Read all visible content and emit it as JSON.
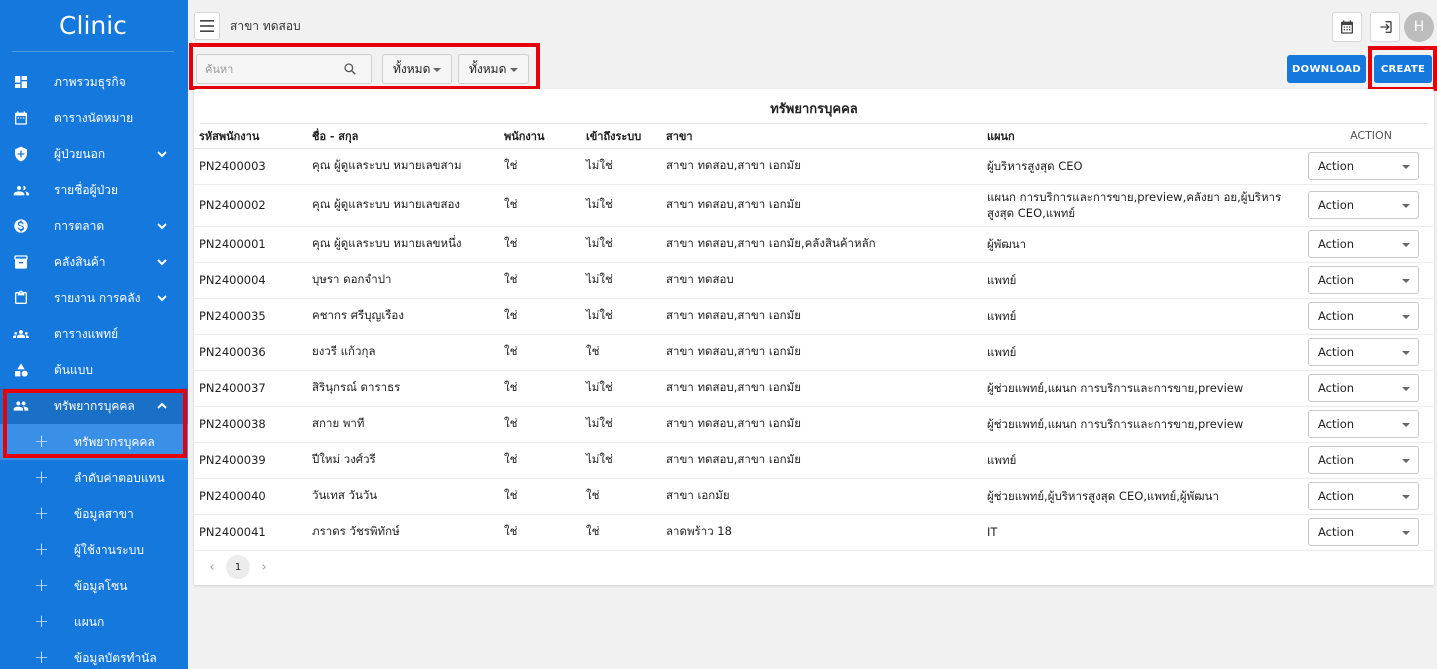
{
  "app": {
    "name": "Clinic"
  },
  "sidebar": {
    "items": [
      {
        "label": "ภาพรวมธุรกิจ",
        "icon": "dashboard-icon",
        "has_chevron": false
      },
      {
        "label": "ตารางนัดหมาย",
        "icon": "calendar-icon",
        "has_chevron": false
      },
      {
        "label": "ผู้ป่วยนอก",
        "icon": "shield-icon",
        "has_chevron": true
      },
      {
        "label": "รายชื่อผู้ป่วย",
        "icon": "patients-icon",
        "has_chevron": false
      },
      {
        "label": "การตลาด",
        "icon": "dollar-icon",
        "has_chevron": true
      },
      {
        "label": "คลังสินค้า",
        "icon": "archive-icon",
        "has_chevron": true
      },
      {
        "label": "รายงาน การคลัง",
        "icon": "clipboard-icon",
        "has_chevron": true
      },
      {
        "label": "ตารางแพทย์",
        "icon": "doctors-icon",
        "has_chevron": false
      },
      {
        "label": "ต้นแบบ",
        "icon": "shapes-icon",
        "has_chevron": false
      },
      {
        "label": "ทรัพยากรบุคคล",
        "icon": "people-icon",
        "has_chevron": true,
        "expanded": true
      }
    ],
    "sub_items": [
      {
        "label": "ทรัพยากรบุคคล",
        "active": true
      },
      {
        "label": "ลำดับค่าตอบแทน"
      },
      {
        "label": "ข้อมูลสาขา"
      },
      {
        "label": "ผู้ใช้งานระบบ"
      },
      {
        "label": "ข้อมูลโซน"
      },
      {
        "label": "แผนก"
      },
      {
        "label": "ข้อมูลบัตรทำนัล"
      }
    ]
  },
  "header": {
    "branch": "สาขา ทดสอบ"
  },
  "toolbar": {
    "search_placeholder": "ค้นหา",
    "filter1": "ทั้งหมด",
    "filter2": "ทั้งหมด",
    "download_label": "DOWNLOAD",
    "create_label": "CREATE"
  },
  "table": {
    "title": "ทรัพยากรบุคคล",
    "columns": [
      "รหัสพนักงาน",
      "ชื่อ - สกุล",
      "พนักงาน",
      "เข้าถึงระบบ",
      "สาขา",
      "แผนก",
      "ACTION"
    ],
    "rows": [
      {
        "id": "PN2400003",
        "name": "คุณ ผู้ดูแลระบบ หมายเลขสาม",
        "staff": "ใช่",
        "access": "ไม่ใช่",
        "branch": "สาขา ทดสอบ,สาขา เอกมัย",
        "dept": "ผู้บริหารสูงสุด CEO",
        "action": "Action"
      },
      {
        "id": "PN2400002",
        "name": "คุณ ผู้ดูแลระบบ หมายเลขสอง",
        "staff": "ใช่",
        "access": "ไม่ใช่",
        "branch": "สาขา ทดสอบ,สาขา เอกมัย",
        "dept": "แผนก การบริการและการขาย,preview,คลังยา อย,ผู้บริหารสูงสุด CEO,แพทย์",
        "action": "Action"
      },
      {
        "id": "PN2400001",
        "name": "คุณ ผู้ดูแลระบบ หมายเลขหนึ่ง",
        "staff": "ใช่",
        "access": "ไม่ใช่",
        "branch": "สาขา ทดสอบ,สาขา เอกมัย,คลังสินค้าหลัก",
        "dept": "ผู้พัฒนา",
        "action": "Action"
      },
      {
        "id": "PN2400004",
        "name": "บุษรา ดอกจำปา",
        "staff": "ใช่",
        "access": "ไม่ใช่",
        "branch": "สาขา ทดสอบ",
        "dept": "แพทย์",
        "action": "Action"
      },
      {
        "id": "PN2400035",
        "name": "คชากร ศรีบุญเรือง",
        "staff": "ใช่",
        "access": "ไม่ใช่",
        "branch": "สาขา ทดสอบ,สาขา เอกมัย",
        "dept": "แพทย์",
        "action": "Action"
      },
      {
        "id": "PN2400036",
        "name": "ยงวรี แก้วกุล",
        "staff": "ใช่",
        "access": "ใช่",
        "branch": "สาขา ทดสอบ,สาขา เอกมัย",
        "dept": "แพทย์",
        "action": "Action"
      },
      {
        "id": "PN2400037",
        "name": "สิรินุกรณ์ ดาราธร",
        "staff": "ใช่",
        "access": "ไม่ใช่",
        "branch": "สาขา ทดสอบ,สาขา เอกมัย",
        "dept": "ผู้ช่วยแพทย์,แผนก การบริการและการขาย,preview",
        "action": "Action"
      },
      {
        "id": "PN2400038",
        "name": "สกาย พาที",
        "staff": "ใช่",
        "access": "ไม่ใช่",
        "branch": "สาขา ทดสอบ,สาขา เอกมัย",
        "dept": "ผู้ช่วยแพทย์,แผนก การบริการและการขาย,preview",
        "action": "Action"
      },
      {
        "id": "PN2400039",
        "name": "ปีใหม่ วงศ์วรี",
        "staff": "ใช่",
        "access": "ไม่ใช่",
        "branch": "สาขา ทดสอบ,สาขา เอกมัย",
        "dept": "แพทย์",
        "action": "Action"
      },
      {
        "id": "PN2400040",
        "name": "วันเทส วันวัน",
        "staff": "ใช่",
        "access": "ใช่",
        "branch": "สาขา เอกมัย",
        "dept": "ผู้ช่วยแพทย์,ผู้บริหารสูงสุด CEO,แพทย์,ผู้พัฒนา",
        "action": "Action"
      },
      {
        "id": "PN2400041",
        "name": "ภราดร วัชรพิทักษ์",
        "staff": "ใช่",
        "access": "ใช่",
        "branch": "ลาดพร้าว 18",
        "dept": "IT",
        "action": "Action"
      }
    ]
  },
  "pagination": {
    "current": "1",
    "prev_icon": "chevron-left-icon",
    "next_icon": "chevron-right-icon"
  },
  "colors": {
    "sidebar": "#1478dc",
    "primary": "#1478dc",
    "highlight": "#e6000a"
  }
}
